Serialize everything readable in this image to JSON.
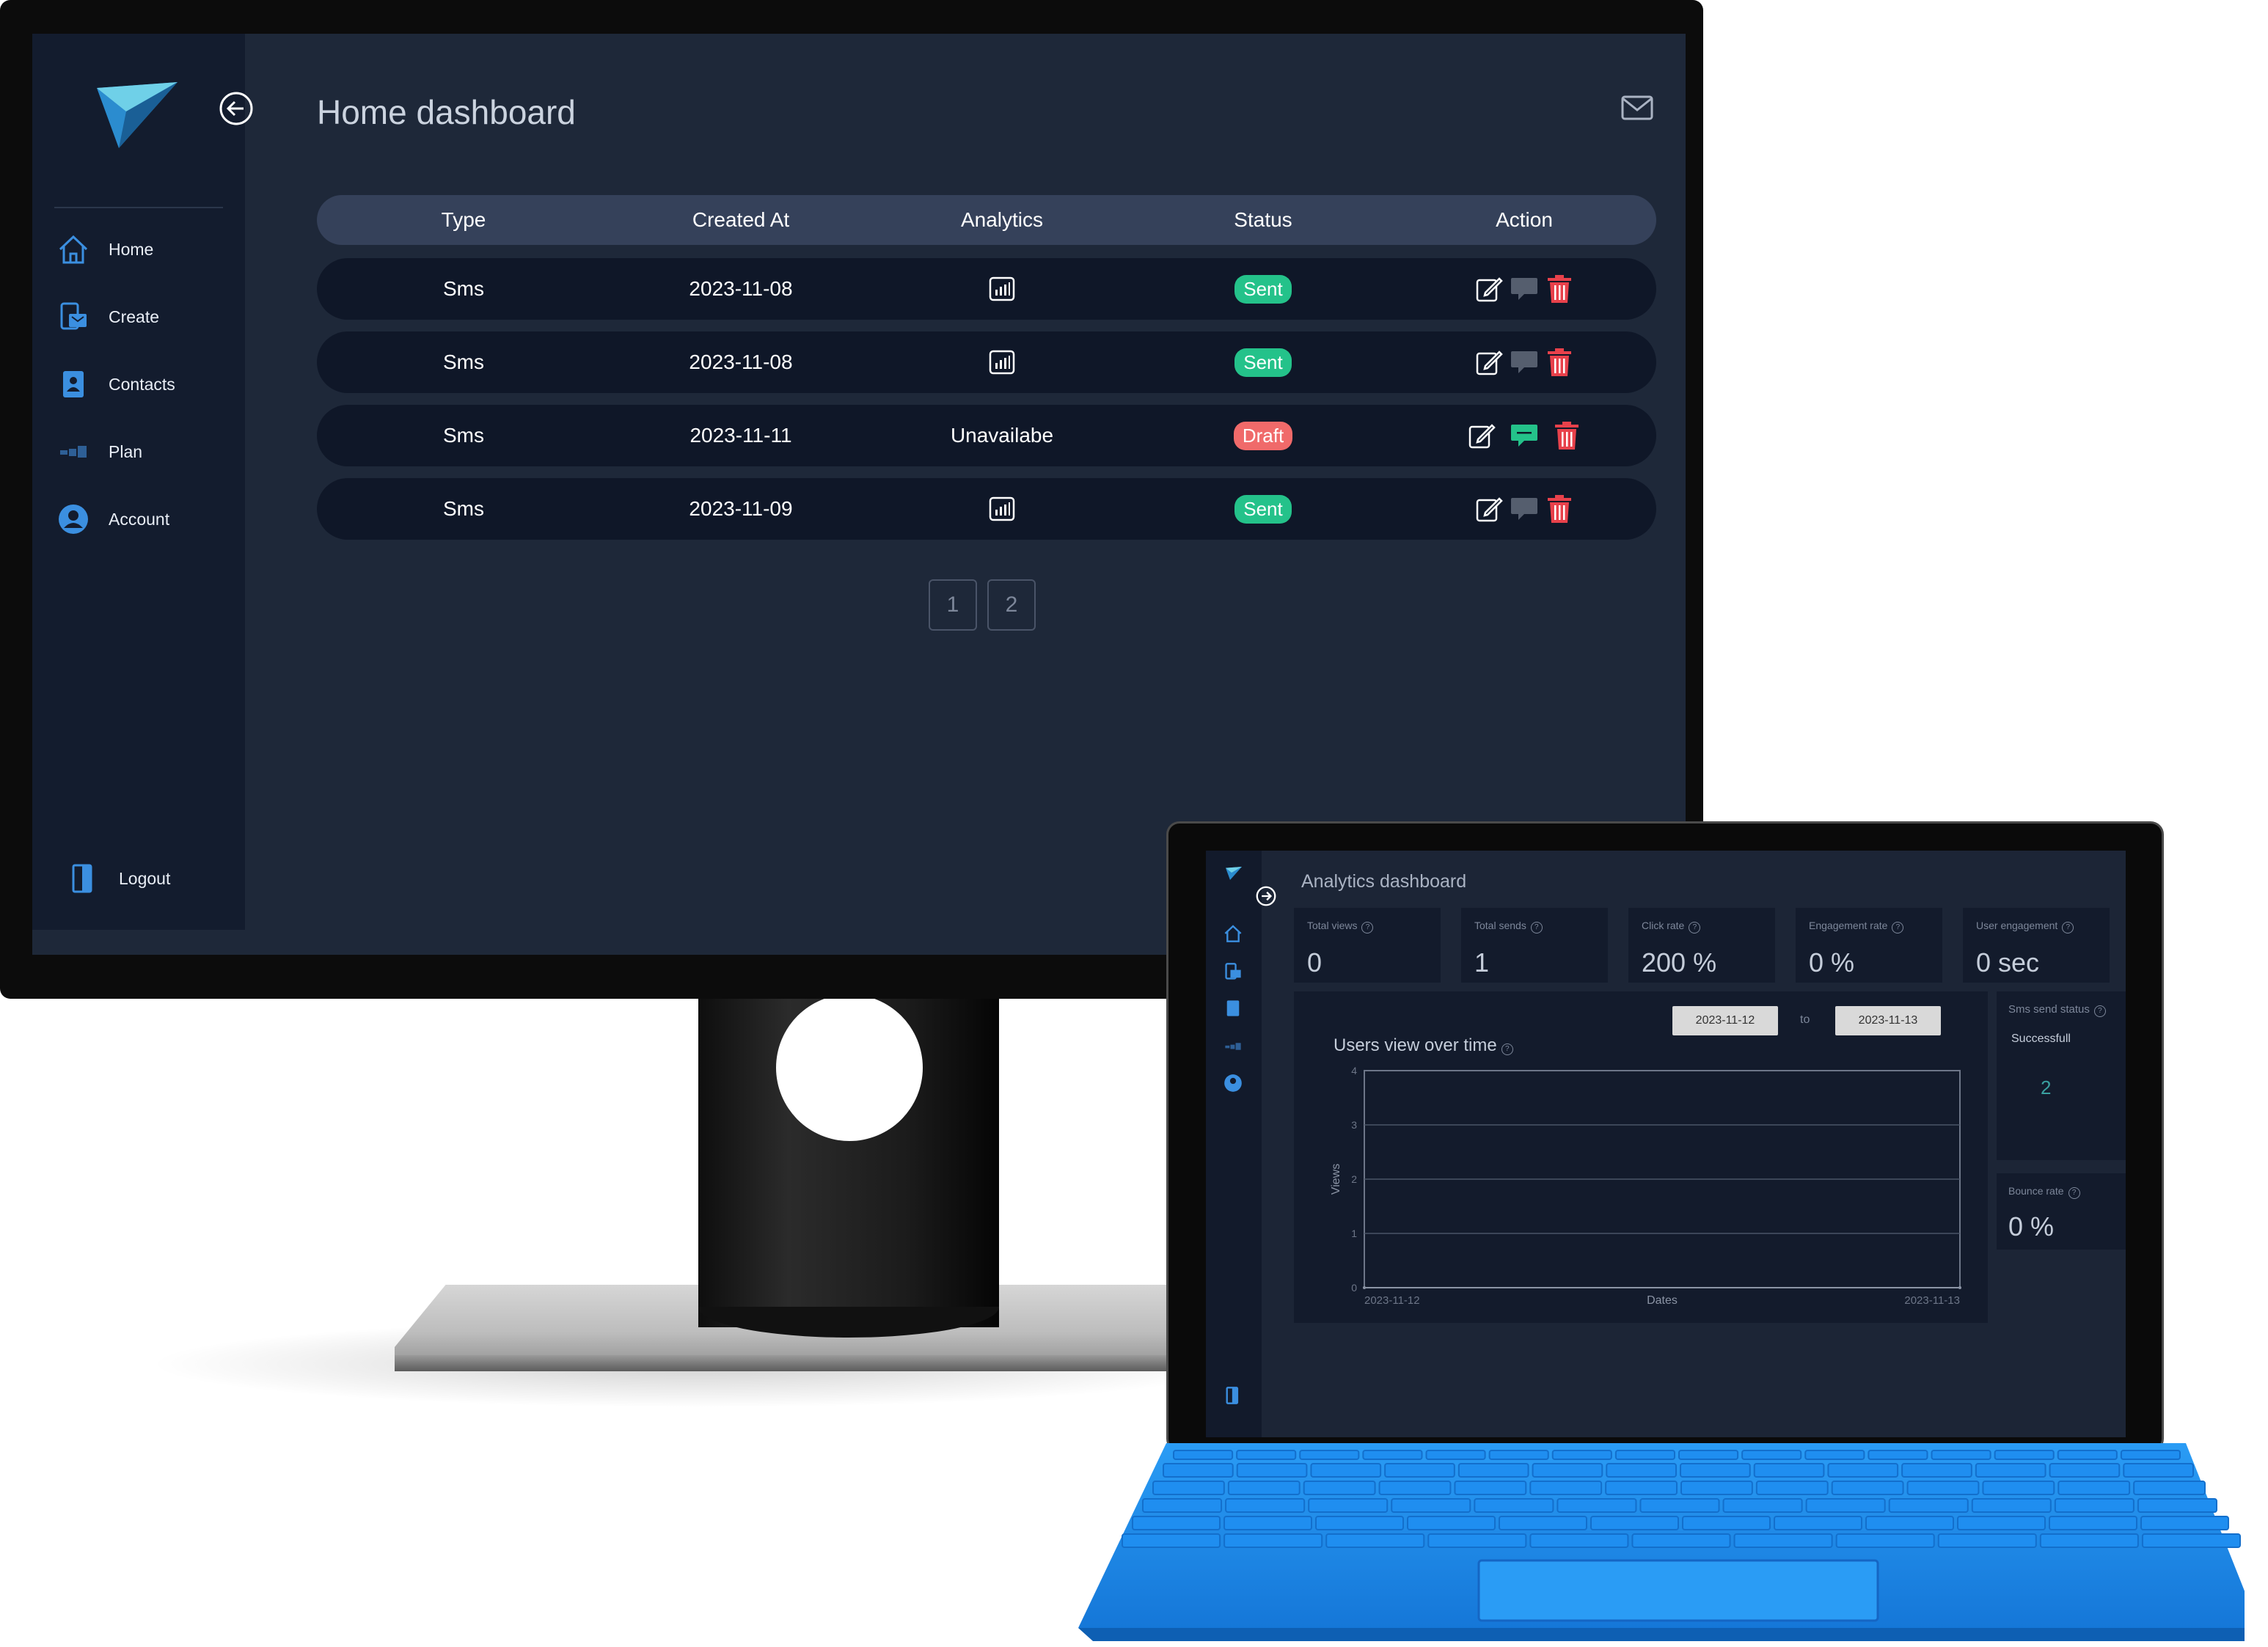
{
  "monitor": {
    "page_title": "Home dashboard",
    "sidebar": {
      "items": [
        {
          "label": "Home",
          "icon": "home-icon"
        },
        {
          "label": "Create",
          "icon": "create-icon"
        },
        {
          "label": "Contacts",
          "icon": "contacts-icon"
        },
        {
          "label": "Plan",
          "icon": "plan-icon"
        },
        {
          "label": "Account",
          "icon": "account-icon"
        }
      ],
      "logout_label": "Logout"
    },
    "table": {
      "headers": [
        "Type",
        "Created At",
        "Analytics",
        "Status",
        "Action"
      ],
      "rows": [
        {
          "type": "Sms",
          "created_at": "2023-11-08",
          "analytics": "",
          "status": "Sent"
        },
        {
          "type": "Sms",
          "created_at": "2023-11-08",
          "analytics": "",
          "status": "Sent"
        },
        {
          "type": "Sms",
          "created_at": "2023-11-11",
          "analytics": "Unavailabe",
          "status": "Draft"
        },
        {
          "type": "Sms",
          "created_at": "2023-11-09",
          "analytics": "",
          "status": "Sent"
        }
      ]
    },
    "pagination": [
      "1",
      "2"
    ]
  },
  "laptop": {
    "page_title": "Analytics dashboard",
    "stats": [
      {
        "label": "Total views",
        "value": "0"
      },
      {
        "label": "Total sends",
        "value": "1"
      },
      {
        "label": "Click rate",
        "value": "200 %"
      },
      {
        "label": "Engagement rate",
        "value": "0 %"
      },
      {
        "label": "User engagement",
        "value": "0 sec"
      }
    ],
    "chart": {
      "title": "Users view over time",
      "date_from": "2023-11-12",
      "to_label": "to",
      "date_to": "2023-11-13"
    },
    "sms_status": {
      "label": "Sms send status",
      "sub_label": "Successfull",
      "value": "2"
    },
    "bounce": {
      "label": "Bounce rate",
      "value": "0 %"
    }
  },
  "chart_data": {
    "type": "line",
    "x": [
      "2023-11-12",
      "2023-11-13"
    ],
    "series": [
      {
        "values": [
          0,
          0
        ]
      }
    ],
    "xlabel": "Dates",
    "ylabel": "Views",
    "ylim": [
      0,
      4
    ],
    "yticks": [
      "0",
      "1",
      "2",
      "3",
      "4"
    ],
    "grid": true
  },
  "colors": {
    "screen_bg": "#1e2839",
    "sidebar_bg": "#131c2e",
    "sent": "#24c28a",
    "draft": "#f06a6a",
    "delete_red": "#e8414b",
    "keyboard_blue": "#1f8ef0"
  }
}
